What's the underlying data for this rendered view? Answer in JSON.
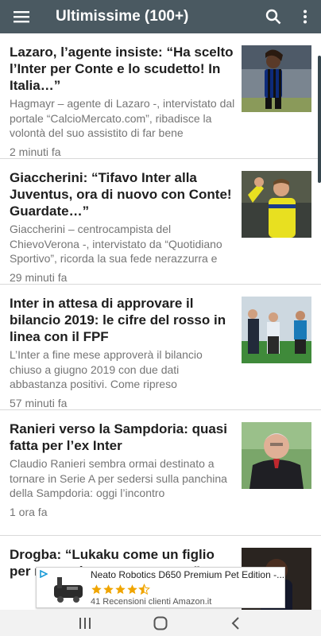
{
  "appbar": {
    "title": "Ultimissime (100+)",
    "menu_icon": "menu-icon",
    "search_icon": "search-icon",
    "more_icon": "more-vert-icon",
    "bg_color": "#4a5961"
  },
  "articles": [
    {
      "headline": "Lazaro, l’agente insiste: “Ha scelto l’Inter per Conte e lo scudetto! In Italia…”",
      "summary": "Hagmayr – agente di Lazaro -, intervistato dal portale “CalcioMercato.com”, ribadisce la volontà del suo assistito di far bene",
      "time": "2 minuti fa"
    },
    {
      "headline": "Giaccherini: “Tifavo Inter alla Juventus, ora di nuovo con Conte! Guardate…”",
      "summary": "Giaccherini – centrocampista del ChievoVerona -, intervistato da “Quotidiano Sportivo”, ricorda la sua fede nerazzurra e",
      "time": "29 minuti fa"
    },
    {
      "headline": "Inter in attesa di approvare il bilancio 2019: le cifre del rosso in linea con il FPF",
      "summary": "L’Inter a fine mese approverà il bilancio chiuso a giugno 2019 con due dati abbastanza positivi. Come ripreso",
      "time": "57 minuti fa"
    },
    {
      "headline": "Ranieri verso la Sampdoria: quasi fatta per l’ex Inter",
      "summary": "Claudio Ranieri sembra ormai destinato a tornare in Serie A per sedersi sulla panchina della Sampdoria: oggi l’incontro",
      "time": "1 ora fa"
    },
    {
      "headline": "Drogba: “Lukaku come un figlio per me, può ancora crescere”",
      "summary": "",
      "time": ""
    }
  ],
  "ad": {
    "title": "Neato Robotics D650 Premium Pet Edition -...",
    "reviews": "41 Recensioni clienti Amazon.it",
    "rating": 4.5,
    "star_color": "#f0a500"
  },
  "navbar": {
    "recents_icon": "recents-icon",
    "home_icon": "home-icon",
    "back_icon": "back-icon"
  }
}
